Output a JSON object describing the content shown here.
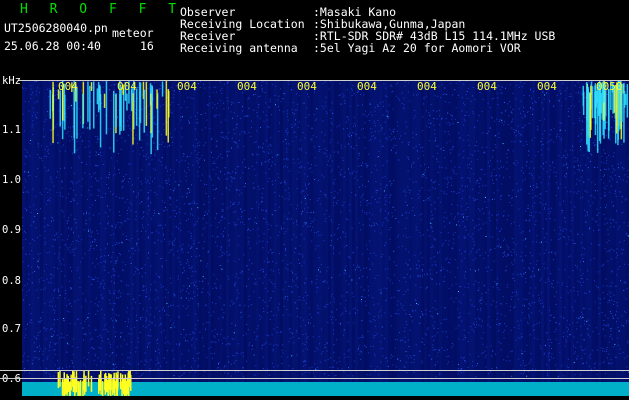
{
  "app_title": "H R O F F T",
  "file_name": "UT2506280040.pn",
  "mode_label": "meteor",
  "datetime": "25.06.28 00:40",
  "count": "16",
  "info": [
    {
      "label": "Observer",
      "value": ":Masaki Kano"
    },
    {
      "label": "Receiving Location",
      "value": ":Shibukawa,Gunma,Japan"
    },
    {
      "label": "Receiver",
      "value": ":RTL-SDR SDR# 43dB L15 114.1MHz USB"
    },
    {
      "label": "Receiving antenna",
      "value": ":5el Yagi Az 20 for Aomori VOR"
    }
  ],
  "y_unit": "kHz",
  "y_ticks": [
    "1.1",
    "1.0",
    "0.9",
    "0.8",
    "0.7",
    "0.6"
  ],
  "x_ticks": [
    "004",
    "004",
    "004",
    "004",
    "004",
    "004",
    "004",
    "004",
    "004",
    "0050"
  ],
  "colors": {
    "background": "#000000",
    "title_green": "#00e000",
    "tick_yellow": "#ffff30",
    "waterfall_base": "#000a5a",
    "signal_cyan": "#30e0ff",
    "signal_yellow": "#ffff20"
  }
}
